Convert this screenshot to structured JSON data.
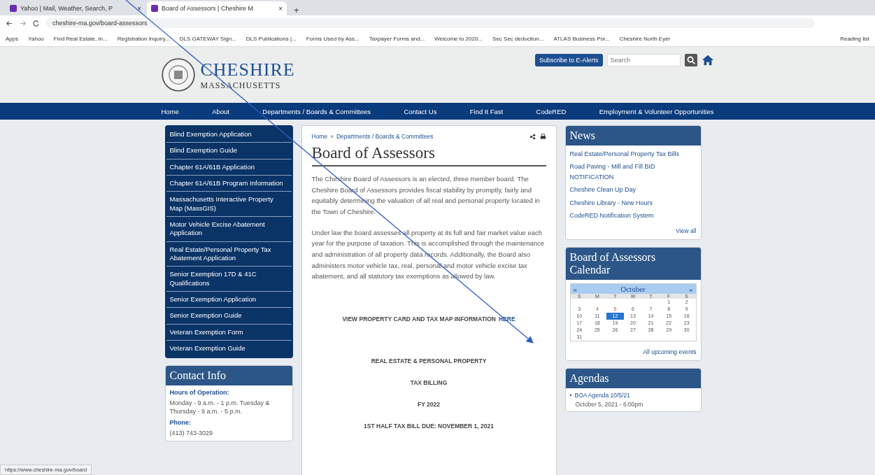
{
  "browser": {
    "tabs": [
      {
        "title": "Yahoo | Mail, Weather, Search, P",
        "selected": false
      },
      {
        "title": "Board of Assessors | Cheshire M",
        "selected": true
      }
    ],
    "tab_close": "×",
    "new_tab": "+",
    "address": "cheshire-ma.gov/board-assessors",
    "bookmarks": [
      "Apps",
      "Yahoo",
      "Find Real Estate, In...",
      "Registration Inquiry...",
      "DLS GATEWAY Sign...",
      "DLS Publications |...",
      "Forms Used by Ass...",
      "Taxpayer Forms and...",
      "Welcome to 2020...",
      "Sec Sec deduction...",
      "ATLAS Business Por...",
      "Cheshire North Eyer"
    ],
    "reading_list": "Reading list",
    "status_url": "https://www.cheshire-ma.gov/board"
  },
  "site": {
    "name": "CHESHIRE",
    "state": "MASSACHUSETTS",
    "subscribe": "Subscribe to E-Alerts",
    "search_placeholder": "Search",
    "nav": [
      "Home",
      "About",
      "Departments / Boards & Committees",
      "Contact Us",
      "Find It Fast",
      "CodeRED",
      "Employment & Volunteer Opportunities"
    ]
  },
  "sidebar": {
    "links": [
      "Blind Exemption Application",
      "Blind Exemption Guide",
      "Chapter 61A/61B Application",
      "Chapter 61A/61B Program Information",
      "Massachusetts Interactive Property Map (MassGIS)",
      "Motor Vehicle Excise Abatement Application",
      "Real Estate/Personal Property Tax Abatement Application",
      "Senior Exemption 17D & 41C Qualifications",
      "Senior Exemption Application",
      "Senior Exemption Guide",
      "Veteran Exemption Form",
      "Veteran Exemption Guide"
    ],
    "contact": {
      "title": "Contact Info",
      "hours_label": "Hours of Operation:",
      "hours": "Monday - 9 a.m. - 1 p.m. Tuesday & Thursday - 9 a.m. - 5 p.m.",
      "phone_label": "Phone:",
      "phone": "(413) 743-3029"
    }
  },
  "article": {
    "breadcrumb": [
      "Home",
      "Departments / Boards & Committees"
    ],
    "breadcrumb_sep": "»",
    "title": "Board of Assessors",
    "paragraphs": [
      "The Cheshire Board of Assessors is an elected, three member board. The Cheshire Board of Assessors provides fiscal stability by promptly, fairly and equitably determining the valuation of all real and personal property located in the Town of Cheshire.",
      "Under law the board assesses all property at its full and fair market value each year for the purpose of taxation. This is accomplished through the maintenance and administration of all property data records. Additionally, the Board also administers motor vehicle tax, real, personal and motor vehicle excise tax abatement, and all statutory tax exemptions as allowed by law."
    ],
    "property_link_text": "VIEW PROPERTY CARD AND TAX MAP INFORMATION",
    "property_link": "HERE",
    "notices": [
      "REAL ESTATE & PERSONAL PROPERTY",
      "TAX BILLING",
      "FY 2022",
      "1ST HALF TAX BILL DUE:  NOVEMBER 1, 2021"
    ]
  },
  "news": {
    "title": "News",
    "items": [
      "Real Estate/Personal Property Tax Bills",
      "Road Paving - Mill and Fill BID NOTIFICATION",
      "Cheshire Clean Up Day",
      "Cheshire Library - New Hours",
      "CodeRED Notification System"
    ],
    "view_all": "View all"
  },
  "calendar": {
    "title": "Board of Assessors Calendar",
    "prev": "«",
    "month": "October",
    "next": "»",
    "weekdays": [
      "S",
      "M",
      "T",
      "W",
      "T",
      "F",
      "S"
    ],
    "days": [
      {
        "n": "1",
        "selected": false,
        "event": false
      },
      {
        "n": "2",
        "selected": false,
        "event": false
      },
      {
        "n": "3",
        "selected": false,
        "event": false
      },
      {
        "n": "4",
        "selected": false,
        "event": true
      },
      {
        "n": "5",
        "selected": false,
        "event": true
      },
      {
        "n": "6",
        "selected": false,
        "event": false
      },
      {
        "n": "7",
        "selected": false,
        "event": false
      },
      {
        "n": "8",
        "selected": false,
        "event": false
      },
      {
        "n": "9",
        "selected": false,
        "event": false
      },
      {
        "n": "10",
        "selected": false,
        "event": false
      },
      {
        "n": "11",
        "selected": false,
        "event": false
      },
      {
        "n": "12",
        "selected": true,
        "event": false
      },
      {
        "n": "13",
        "selected": false,
        "event": false
      },
      {
        "n": "14",
        "selected": false,
        "event": false
      },
      {
        "n": "15",
        "selected": false,
        "event": false
      },
      {
        "n": "16",
        "selected": false,
        "event": false
      },
      {
        "n": "17",
        "selected": false,
        "event": false
      },
      {
        "n": "18",
        "selected": false,
        "event": false
      },
      {
        "n": "19",
        "selected": false,
        "event": false
      },
      {
        "n": "20",
        "selected": false,
        "event": false
      },
      {
        "n": "21",
        "selected": false,
        "event": false
      },
      {
        "n": "22",
        "selected": false,
        "event": false
      },
      {
        "n": "23",
        "selected": false,
        "event": false
      },
      {
        "n": "24",
        "selected": false,
        "event": false
      },
      {
        "n": "25",
        "selected": false,
        "event": false
      },
      {
        "n": "26",
        "selected": false,
        "event": false
      },
      {
        "n": "27",
        "selected": false,
        "event": false
      },
      {
        "n": "28",
        "selected": false,
        "event": false
      },
      {
        "n": "29",
        "selected": false,
        "event": false
      },
      {
        "n": "30",
        "selected": false,
        "event": false
      },
      {
        "n": "31",
        "selected": false,
        "event": false
      }
    ],
    "all_events": "All upcoming events"
  },
  "agendas": {
    "title": "Agendas",
    "items": [
      {
        "bullet": "•",
        "title": "BOA Agenda 10/5/21",
        "date": "October 5, 2021 - 6:00pm"
      }
    ]
  }
}
